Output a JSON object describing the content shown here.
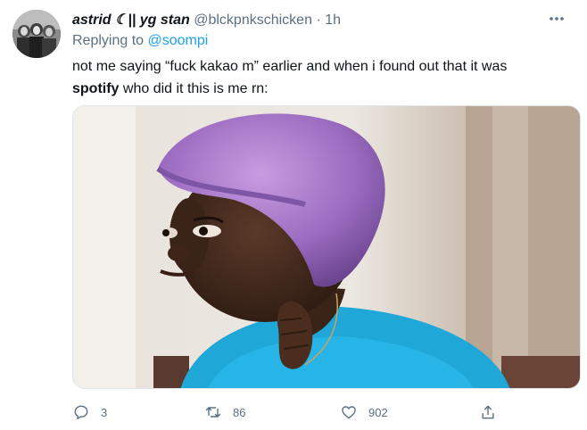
{
  "tweet": {
    "display_name": "astrid ☾|| yg stan",
    "handle": "@blckpnkschicken",
    "separator": "·",
    "time": "1h",
    "replying_prefix": "Replying to",
    "replying_to": "@soompi",
    "text_part1": "not me saying “fuck kakao m” earlier and when i found out that it was",
    "text_bold": "spotify",
    "text_part2": " who did it this is me rn:"
  },
  "actions": {
    "reply_count": "3",
    "retweet_count": "86",
    "like_count": "902"
  },
  "icons": {
    "more": "more-horizontal-icon",
    "reply": "comment-icon",
    "retweet": "retweet-icon",
    "like": "heart-icon",
    "share": "share-icon"
  },
  "colors": {
    "text": "#0f1419",
    "secondary": "#5b7083",
    "link": "#1da1f2"
  }
}
